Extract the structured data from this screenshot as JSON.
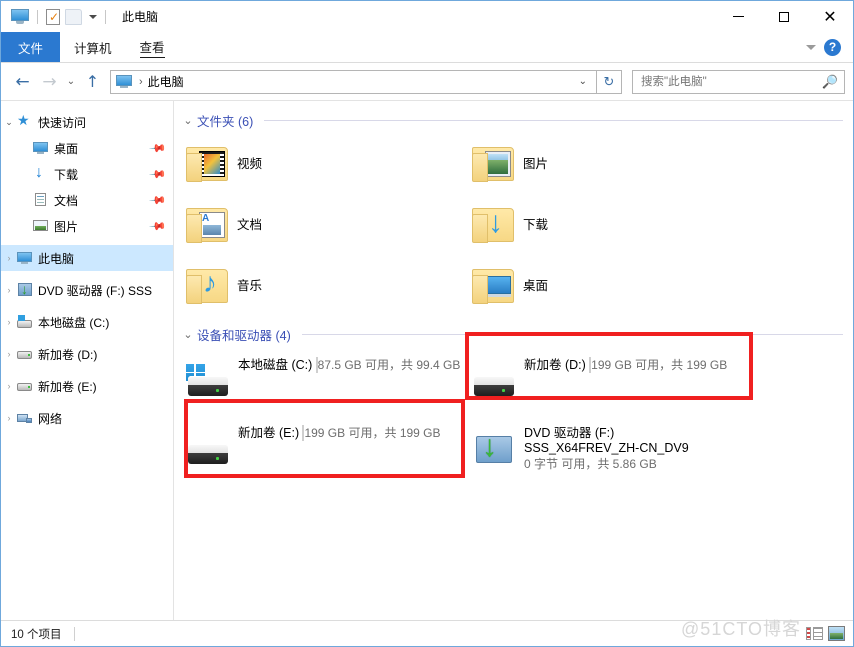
{
  "window": {
    "title": "此电脑",
    "quick_access_icons": [
      "pc-icon",
      "properties-icon",
      "new-folder-icon",
      "customize-caret-icon"
    ],
    "minimize_label": "—",
    "maximize_label": "□",
    "close_label": "✕"
  },
  "ribbon": {
    "tabs": [
      {
        "label": "文件",
        "active": true
      },
      {
        "label": "计算机",
        "active": false
      },
      {
        "label": "查看",
        "active": false
      }
    ],
    "collapse_icon": "chevron-down-icon",
    "help_label": "?"
  },
  "address": {
    "back_label": "←",
    "forward_label": "→",
    "recent_label": "⌄",
    "up_label": "↑",
    "crumb_icon": "pc-icon",
    "crumb_sep": "›",
    "crumb": "此电脑",
    "dropdown_label": "⌄",
    "refresh_label": "↻"
  },
  "search": {
    "placeholder": "搜索\"此电脑\"",
    "value": "",
    "icon": "search-icon"
  },
  "sidebar": {
    "items": [
      {
        "label": "快速访问",
        "expander": "⌄",
        "icon": "star-icon",
        "indent": 0,
        "selected": false,
        "pinned": false
      },
      {
        "label": "桌面",
        "expander": "",
        "icon": "desktop-icon",
        "indent": 1,
        "selected": false,
        "pinned": true
      },
      {
        "label": "下载",
        "expander": "",
        "icon": "download-icon",
        "indent": 1,
        "selected": false,
        "pinned": true
      },
      {
        "label": "文档",
        "expander": "",
        "icon": "documents-icon",
        "indent": 1,
        "selected": false,
        "pinned": true
      },
      {
        "label": "图片",
        "expander": "",
        "icon": "pictures-icon",
        "indent": 1,
        "selected": false,
        "pinned": true
      },
      {
        "label": "此电脑",
        "expander": "›",
        "icon": "pc-icon",
        "indent": 0,
        "selected": true,
        "pinned": false
      },
      {
        "label": "DVD 驱动器 (F:) SSS",
        "expander": "›",
        "icon": "dvd-drive-icon",
        "indent": 0,
        "selected": false,
        "pinned": false
      },
      {
        "label": "本地磁盘 (C:)",
        "expander": "›",
        "icon": "windows-drive-icon",
        "indent": 0,
        "selected": false,
        "pinned": false
      },
      {
        "label": "新加卷 (D:)",
        "expander": "›",
        "icon": "hard-drive-icon",
        "indent": 0,
        "selected": false,
        "pinned": false
      },
      {
        "label": "新加卷 (E:)",
        "expander": "›",
        "icon": "hard-drive-icon",
        "indent": 0,
        "selected": false,
        "pinned": false
      },
      {
        "label": "网络",
        "expander": "›",
        "icon": "network-icon",
        "indent": 0,
        "selected": false,
        "pinned": false
      }
    ]
  },
  "content": {
    "groups": [
      {
        "header": "文件夹 (6)",
        "chevron": "⌄",
        "kind": "folders",
        "items": [
          {
            "name": "视频",
            "icon": "folder-videos-icon"
          },
          {
            "name": "图片",
            "icon": "folder-pictures-icon"
          },
          {
            "name": "文档",
            "icon": "folder-documents-icon"
          },
          {
            "name": "下载",
            "icon": "folder-downloads-icon"
          },
          {
            "name": "音乐",
            "icon": "folder-music-icon"
          },
          {
            "name": "桌面",
            "icon": "folder-desktop-icon"
          }
        ]
      },
      {
        "header": "设备和驱动器 (4)",
        "chevron": "⌄",
        "kind": "drives",
        "items": [
          {
            "name": "本地磁盘 (C:)",
            "subtitle": "",
            "free": "87.5 GB 可用，共 99.4 GB",
            "used_percent": 12,
            "icon": "windows-drive-icon",
            "has_meter": true,
            "highlighted": false
          },
          {
            "name": "新加卷 (D:)",
            "subtitle": "",
            "free": "199 GB 可用，共 199 GB",
            "used_percent": 0,
            "icon": "hard-drive-icon",
            "has_meter": true,
            "highlighted": true
          },
          {
            "name": "新加卷 (E:)",
            "subtitle": "",
            "free": "199 GB 可用，共 199 GB",
            "used_percent": 0,
            "icon": "hard-drive-icon",
            "has_meter": true,
            "highlighted": true
          },
          {
            "name": "DVD 驱动器 (F:)",
            "subtitle": "SSS_X64FREV_ZH-CN_DV9",
            "free": "0 字节 可用，共 5.86 GB",
            "used_percent": 0,
            "icon": "dvd-drive-icon",
            "has_meter": false,
            "highlighted": false
          }
        ]
      }
    ]
  },
  "status": {
    "item_count": "10 个项目",
    "view_buttons": [
      "details-view-icon",
      "large-icons-view-icon"
    ]
  },
  "watermark": "@51CTO博客",
  "colors": {
    "accent": "#2b79d0",
    "selection": "#cce8ff",
    "group_header": "#3a4fb5",
    "meter_fill": "#2196e3",
    "annotation": "#f02020"
  }
}
